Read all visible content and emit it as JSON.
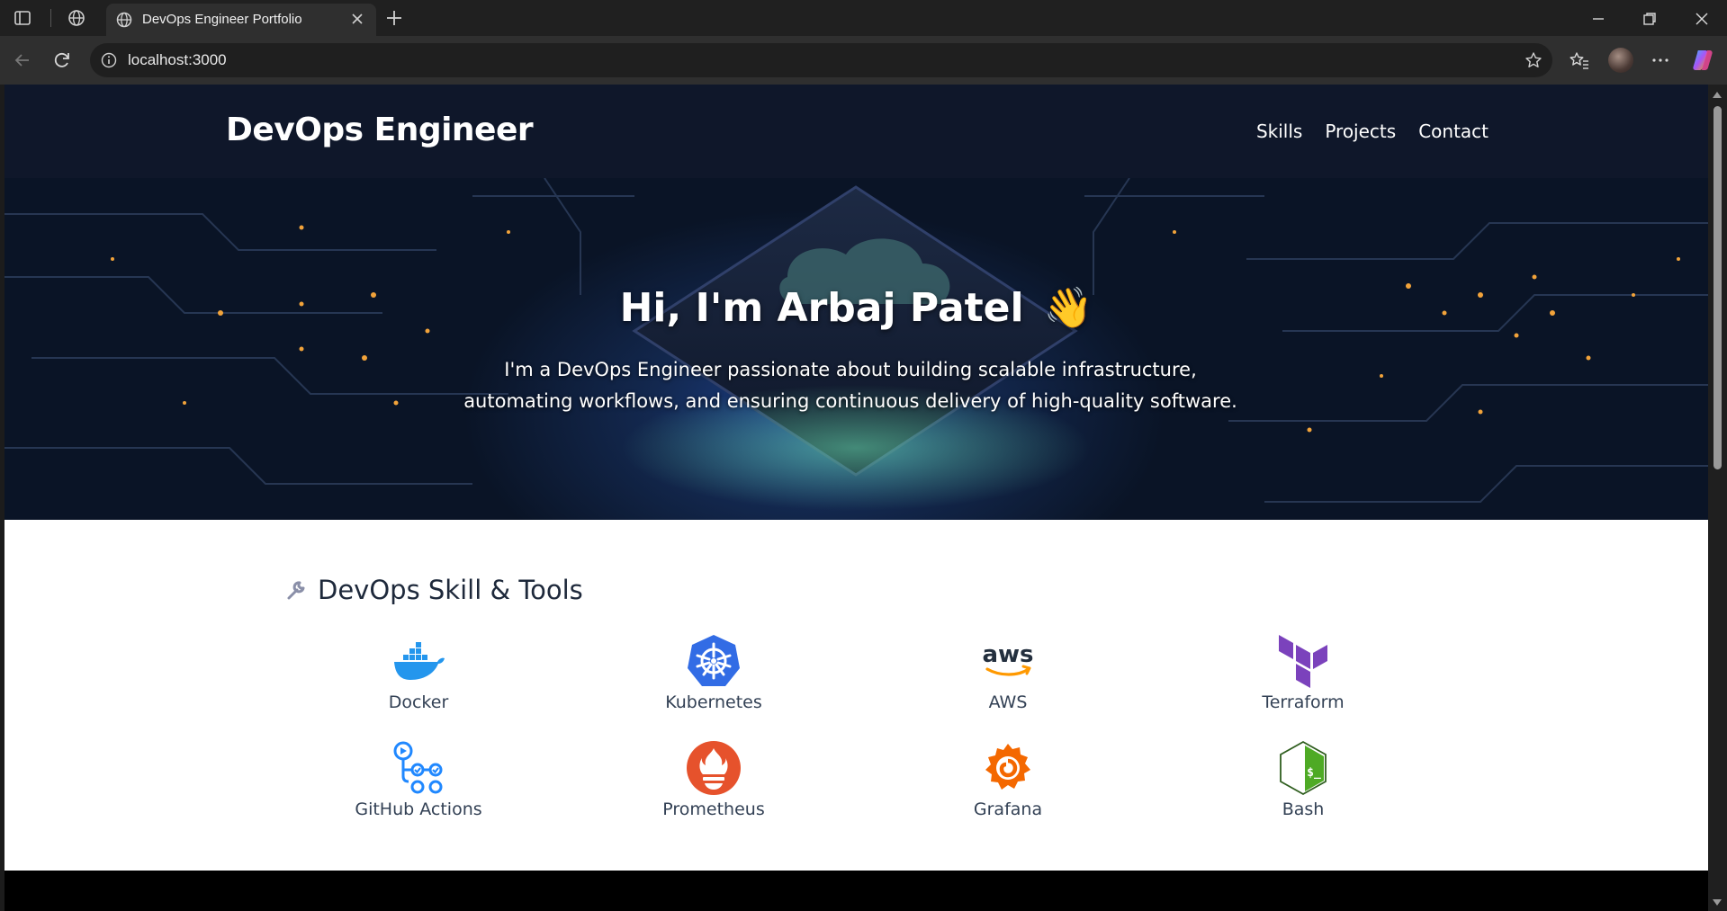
{
  "browser": {
    "tab_title": "DevOps Engineer Portfolio",
    "url": "localhost:3000"
  },
  "site": {
    "brand": "DevOps Engineer",
    "nav": [
      "Skills",
      "Projects",
      "Contact"
    ]
  },
  "hero": {
    "title": "Hi, I'm Arbaj Patel",
    "emoji": "👋",
    "subtitle": "I'm a DevOps Engineer passionate about building scalable infrastructure, automating workflows, and ensuring continuous delivery of high-quality software."
  },
  "skills": {
    "heading": "DevOps Skill & Tools",
    "items": [
      {
        "label": "Docker",
        "icon": "docker-icon"
      },
      {
        "label": "Kubernetes",
        "icon": "kubernetes-icon"
      },
      {
        "label": "AWS",
        "icon": "aws-icon"
      },
      {
        "label": "Terraform",
        "icon": "terraform-icon"
      },
      {
        "label": "GitHub Actions",
        "icon": "github-actions-icon"
      },
      {
        "label": "Prometheus",
        "icon": "prometheus-icon"
      },
      {
        "label": "Grafana",
        "icon": "grafana-icon"
      },
      {
        "label": "Bash",
        "icon": "bash-icon"
      }
    ]
  },
  "colors": {
    "header_bg": "#0f172a",
    "docker": "#2496ed",
    "kubernetes": "#326ce5",
    "terraform": "#7b42bc",
    "prometheus": "#e6522c",
    "grafana": "#f46800",
    "bash": "#4eaa25"
  }
}
